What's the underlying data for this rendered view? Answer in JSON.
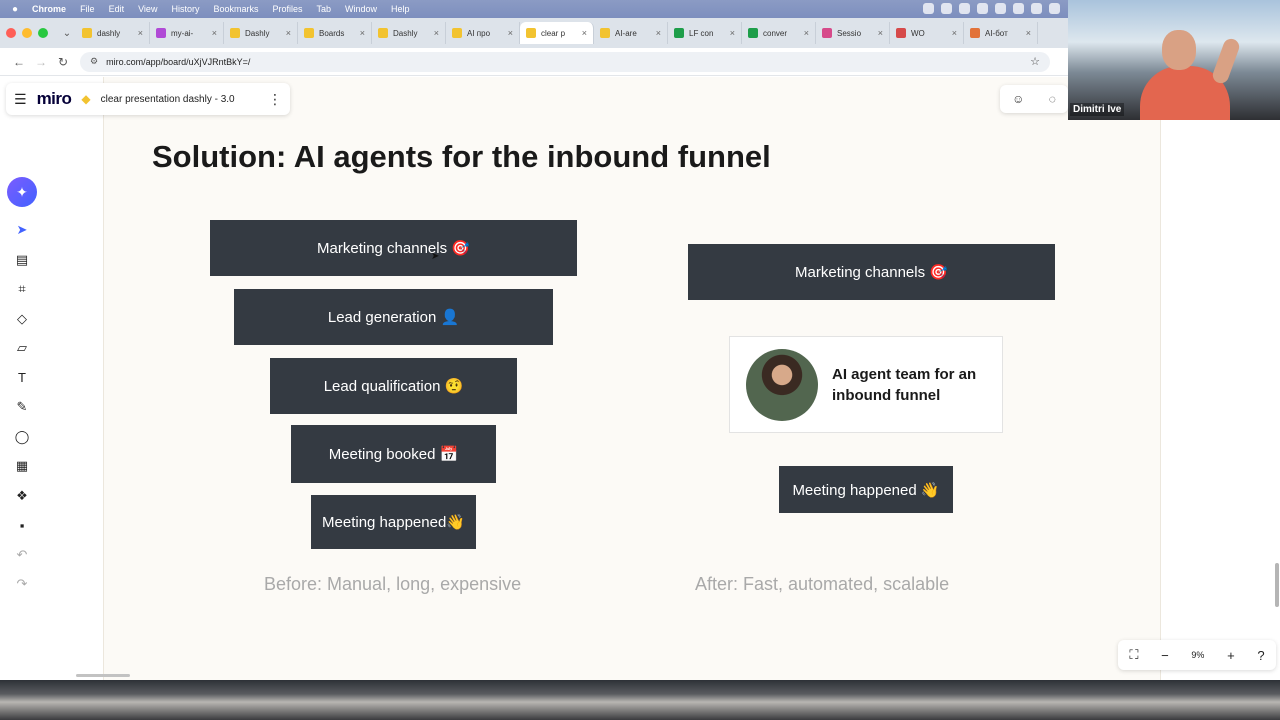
{
  "menubar": {
    "items": [
      "Chrome",
      "File",
      "Edit",
      "View",
      "History",
      "Bookmarks",
      "Profiles",
      "Tab",
      "Window",
      "Help"
    ]
  },
  "browser": {
    "tabs": [
      {
        "label": "dashly",
        "color": "#f2c330"
      },
      {
        "label": "my-ai-",
        "color": "#b04ad6"
      },
      {
        "label": "Dashly",
        "color": "#f2c330"
      },
      {
        "label": "Boards",
        "color": "#f2c330"
      },
      {
        "label": "Dashly",
        "color": "#f2c330"
      },
      {
        "label": "AI про",
        "color": "#f2c330"
      },
      {
        "label": "clear p",
        "color": "#f2c330"
      },
      {
        "label": "AI-are",
        "color": "#f2c330"
      },
      {
        "label": "LF con",
        "color": "#1e9e4a"
      },
      {
        "label": "conver",
        "color": "#1e9e4a"
      },
      {
        "label": "Sessio",
        "color": "#d64a8a"
      },
      {
        "label": "WO",
        "color": "#d64a4a"
      },
      {
        "label": "AI-бот",
        "color": "#e2733a"
      }
    ],
    "url": "miro.com/app/board/uXjVJRntBkY=/"
  },
  "miro": {
    "logo": "miro",
    "board_name": "clear presentation dashly - 3.0",
    "zoom": "9%"
  },
  "slide": {
    "title": "Solution: AI agents for the inbound funnel",
    "before_steps": [
      "Marketing channels 🎯",
      "Lead generation 👤",
      "Lead qualification 🤨",
      "Meeting booked 📅",
      "Meeting happened👋"
    ],
    "after_top": "Marketing channels 🎯",
    "agent_label": "AI agent team for an inbound funnel",
    "after_bottom": "Meeting happened 👋",
    "before_caption": "Before: Manual, long, expensive",
    "after_caption": "After: Fast, automated, scalable"
  },
  "video": {
    "participant_name": "Dimitri Ive"
  },
  "colors": {
    "funnel_box": "#343a42",
    "miro_accent": "#4262ff",
    "caption": "#a9a9a9"
  }
}
